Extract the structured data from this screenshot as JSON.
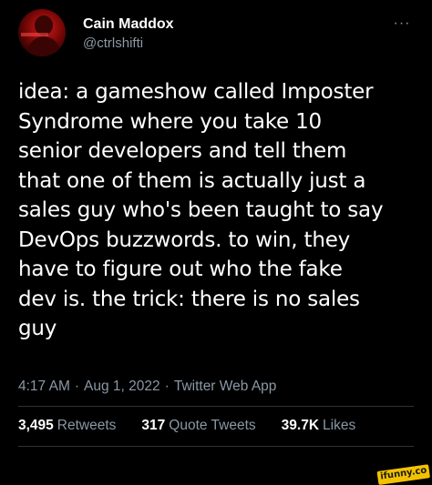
{
  "tweet": {
    "author": {
      "display_name": "Cain Maddox",
      "handle": "@ctrlshifti",
      "avatar_icon": "profile-photo-avatar"
    },
    "more_icon": "ellipsis-icon",
    "more_label": "···",
    "text": "idea: a gameshow called Imposter\nSyndrome where you take 10\nsenior developers and tell them\nthat one of them is actually just a\nsales guy who's been taught to say\nDevOps buzzwords. to win, they\nhave to figure out who the fake\ndev is. the trick: there is no sales\nguy",
    "meta": {
      "time": "4:17 AM",
      "date": "Aug 1, 2022",
      "source": "Twitter Web App",
      "separator": "·"
    },
    "stats": {
      "retweets_count": "3,495",
      "retweets_label": "Retweets",
      "quote_tweets_count": "317",
      "quote_tweets_label": "Quote Tweets",
      "likes_count": "39.7K",
      "likes_label": "Likes"
    }
  },
  "watermark": {
    "text": "ifunny.co"
  },
  "colors": {
    "background": "#000000",
    "primary_text": "#ffffff",
    "secondary_text": "#8b98a5",
    "divider": "#2f3336",
    "watermark_bg": "#f2c200"
  }
}
